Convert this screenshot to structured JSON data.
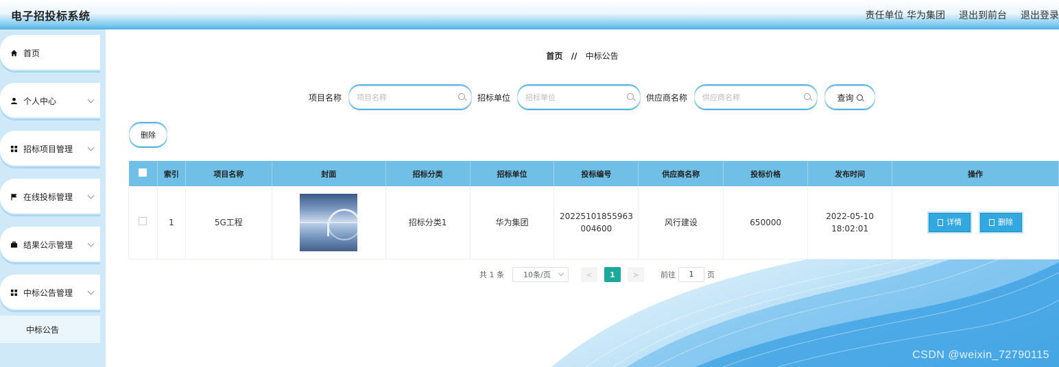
{
  "header": {
    "title": "电子招投标系统",
    "unit_label": "责任单位 华为集团",
    "exit_front": "退出到前台",
    "logout": "退出登录"
  },
  "sidebar": {
    "items": [
      {
        "label": "首页",
        "icon": "home-icon",
        "has_children": false
      },
      {
        "label": "个人中心",
        "icon": "user-icon",
        "has_children": true
      },
      {
        "label": "招标项目管理",
        "icon": "grid-icon",
        "has_children": true
      },
      {
        "label": "在线投标管理",
        "icon": "flag-icon",
        "has_children": true
      },
      {
        "label": "结果公示管理",
        "icon": "briefcase-icon",
        "has_children": true
      },
      {
        "label": "中标公告管理",
        "icon": "grid-icon",
        "has_children": true
      }
    ],
    "sub_item": "中标公告"
  },
  "breadcrumb": {
    "home": "首页",
    "sep": "//",
    "current": "中标公告"
  },
  "search": {
    "project_label": "项目名称",
    "project_placeholder": "项目名称",
    "tender_label": "招标单位",
    "tender_placeholder": "招标单位",
    "supplier_label": "供应商名称",
    "supplier_placeholder": "供应商名称",
    "query_label": "查询"
  },
  "toolbar": {
    "delete_label": "删除"
  },
  "table": {
    "headers": [
      "索引",
      "项目名称",
      "封面",
      "招标分类",
      "招标单位",
      "投标编号",
      "供应商名称",
      "投标价格",
      "发布时间",
      "操作"
    ],
    "rows": [
      {
        "index": "1",
        "project": "5G工程",
        "category": "招标分类1",
        "tender_unit": "华为集团",
        "bid_no": "20225101855963004600",
        "supplier": "风行建设",
        "price": "650000",
        "time": "2022-05-10 18:02:01",
        "detail_label": "详情",
        "delete_label": "删除"
      }
    ]
  },
  "pager": {
    "total": "共 1 条",
    "page_size": "10条/页",
    "prev": "<",
    "current": "1",
    "next": ">",
    "goto": "前往",
    "goto_value": "1",
    "page_unit": "页"
  },
  "watermark": "CSDN @weixin_72790115"
}
